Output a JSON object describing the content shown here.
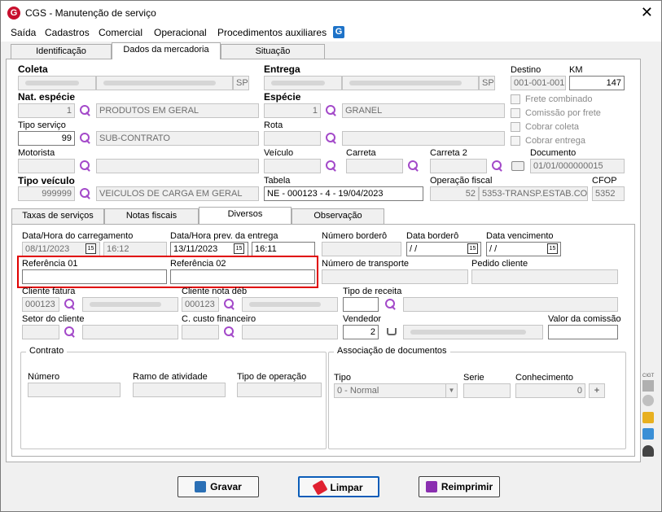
{
  "window": {
    "title": "CGS - Manutenção de serviço",
    "close": "✕"
  },
  "menu": [
    "Saída",
    "Cadastros",
    "Comercial",
    "Operacional",
    "Procedimentos auxiliares"
  ],
  "tabs_top": [
    "Identificação",
    "Dados da mercadoria",
    "Situação"
  ],
  "coleta": {
    "label": "Coleta",
    "uf": "SP"
  },
  "entrega": {
    "label": "Entrega",
    "uf": "SP"
  },
  "destino": {
    "label": "Destino",
    "value": "001-001-001"
  },
  "km": {
    "label": "KM",
    "value": "147"
  },
  "nat_especie": {
    "label": "Nat. espécie",
    "code": "1",
    "desc": "PRODUTOS EM GERAL"
  },
  "especie": {
    "label": "Espécie",
    "code": "1",
    "desc": "GRANEL"
  },
  "checks": [
    "Frete combinado",
    "Comissão por frete",
    "Cobrar coleta",
    "Cobrar entrega"
  ],
  "tipo_servico": {
    "label": "Tipo serviço",
    "code": "99",
    "desc": "SUB-CONTRATO"
  },
  "rota": {
    "label": "Rota"
  },
  "motorista": {
    "label": "Motorista"
  },
  "veiculo": {
    "label": "Veículo"
  },
  "carreta": {
    "label": "Carreta"
  },
  "carreta2": {
    "label": "Carreta 2"
  },
  "documento": {
    "label": "Documento",
    "value": "01/01/000000015"
  },
  "tipo_veiculo": {
    "label": "Tipo veículo",
    "code": "999999",
    "desc": "VEICULOS DE CARGA EM GERAL"
  },
  "tabela": {
    "label": "Tabela",
    "value": "NE - 000123 - 4 - 19/04/2023"
  },
  "op_fiscal": {
    "label": "Operação fiscal",
    "code": "52",
    "desc": "5353-TRANSP.ESTAB.CO"
  },
  "cfop": {
    "label": "CFOP",
    "value": "5352"
  },
  "tabs_bottom": [
    "Taxas de serviços",
    "Notas fiscais",
    "Diversos",
    "Observação"
  ],
  "diversos": {
    "data_carregamento": {
      "label": "Data/Hora do carregamento",
      "date": "08/11/2023",
      "time": "16:12"
    },
    "data_entrega": {
      "label": "Data/Hora prev. da entrega",
      "date": "13/11/2023",
      "time": "16:11"
    },
    "num_bordero": {
      "label": "Número borderô"
    },
    "data_bordero": {
      "label": "Data borderô",
      "value": " / /"
    },
    "data_venc": {
      "label": "Data vencimento",
      "value": " / /"
    },
    "ref01": {
      "label": "Referência 01"
    },
    "ref02": {
      "label": "Referência 02"
    },
    "num_transporte": {
      "label": "Número de transporte"
    },
    "pedido_cliente": {
      "label": "Pedido cliente"
    },
    "cliente_fatura": {
      "label": "Cliente fatura",
      "value": "000123"
    },
    "cliente_nota": {
      "label": "Cliente nota déb",
      "value": "000123"
    },
    "tipo_receita": {
      "label": "Tipo de receita"
    },
    "setor_cliente": {
      "label": "Setor do cliente"
    },
    "custo_fin": {
      "label": "C. custo financeiro"
    },
    "vendedor": {
      "label": "Vendedor",
      "value": "2"
    },
    "valor_comissao": {
      "label": "Valor da comissão"
    },
    "contrato": {
      "title": "Contrato",
      "numero": "Número",
      "ramo": "Ramo de atividade",
      "tipo_op": "Tipo de operação"
    },
    "assoc": {
      "title": "Associação de documentos",
      "tipo": "Tipo",
      "tipo_value": "0 - Normal",
      "serie": "Serie",
      "conhecimento": "Conhecimento",
      "conh_value": "0",
      "plus": "+"
    }
  },
  "buttons": {
    "gravar": "Gravar",
    "limpar": "Limpar",
    "reimprimir": "Reimprimir"
  },
  "sidebar": {
    "cigt": "CIGT"
  },
  "colors": {
    "accent": "#a349c9",
    "highlight": "#e00000",
    "brand": "#c8102e"
  }
}
